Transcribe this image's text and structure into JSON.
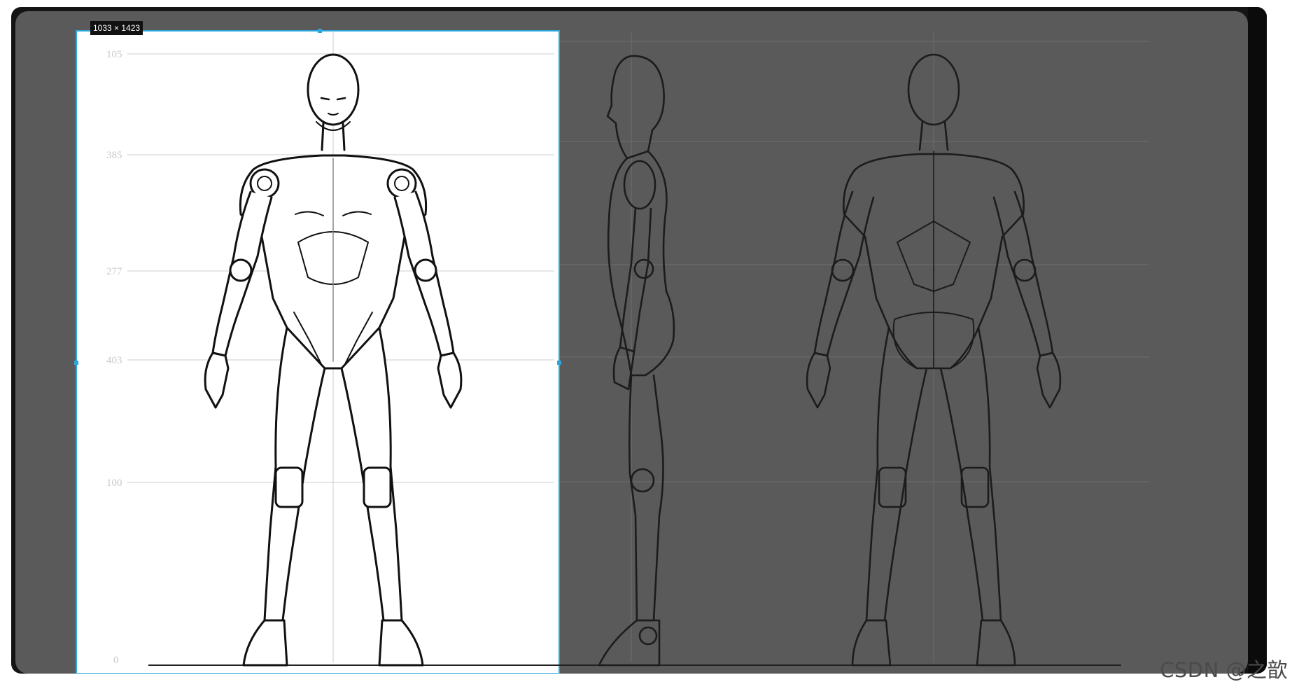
{
  "selection": {
    "size_label": "1033 × 1423"
  },
  "ruler": {
    "ticks": [
      "105",
      "385",
      "277",
      "403",
      "100",
      "0"
    ]
  },
  "views": [
    "front",
    "side",
    "back"
  ],
  "watermark": "CSDN @之歆",
  "colors": {
    "selection_bg": "#ffffff",
    "canvas_dim": "#5a5a5a",
    "selection_border": "#2aa7d8",
    "line_art": "#111111"
  }
}
